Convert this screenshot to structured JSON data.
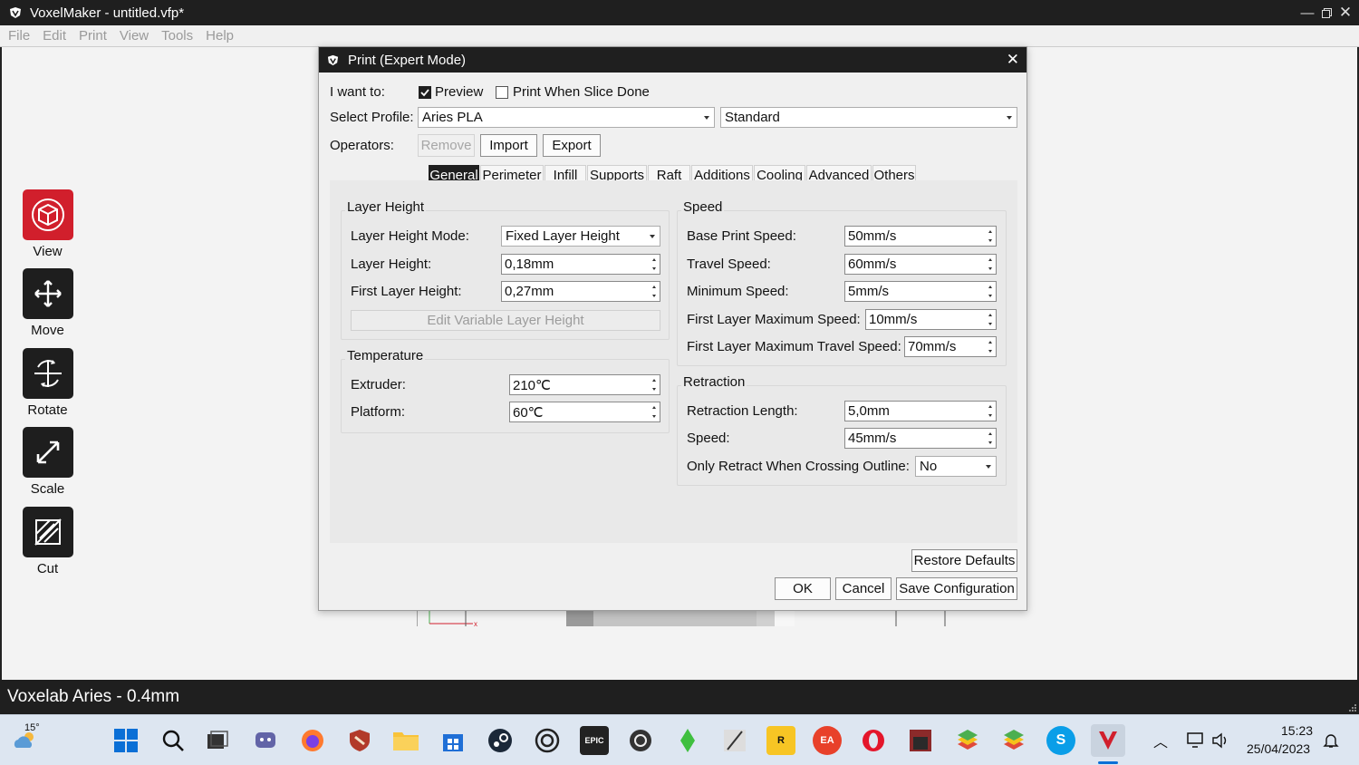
{
  "app": {
    "title": "VoxelMaker - untitled.vfp*"
  },
  "menu": [
    "File",
    "Edit",
    "Print",
    "View",
    "Tools",
    "Help"
  ],
  "tools": [
    {
      "label": "View",
      "icon": "view-cube-icon",
      "active": true
    },
    {
      "label": "Move",
      "icon": "move-arrows-icon",
      "active": false
    },
    {
      "label": "Rotate",
      "icon": "rotate-icon",
      "active": false
    },
    {
      "label": "Scale",
      "icon": "scale-icon",
      "active": false
    },
    {
      "label": "Cut",
      "icon": "cut-icon",
      "active": false
    }
  ],
  "dialog": {
    "title": "Print (Expert Mode)",
    "i_want_to_label": "I want to:",
    "preview_label": "Preview",
    "preview_checked": true,
    "print_when_done_label": "Print When Slice Done",
    "print_when_done_checked": false,
    "select_profile_label": "Select Profile:",
    "profile_value": "Aries PLA",
    "quality_value": "Standard",
    "operators_label": "Operators:",
    "remove_label": "Remove",
    "import_label": "Import",
    "export_label": "Export",
    "tabs": [
      "General",
      "Perimeter",
      "Infill",
      "Supports",
      "Raft",
      "Additions",
      "Cooling",
      "Advanced",
      "Others"
    ],
    "selected_tab": "General",
    "layer_height": {
      "title": "Layer Height",
      "mode_label": "Layer Height Mode:",
      "mode_value": "Fixed Layer Height",
      "height_label": "Layer Height:",
      "height_value": "0,18mm",
      "first_label": "First Layer Height:",
      "first_value": "0,27mm",
      "edit_variable_label": "Edit Variable Layer Height"
    },
    "temperature": {
      "title": "Temperature",
      "extruder_label": "Extruder:",
      "extruder_value": "210℃",
      "platform_label": "Platform:",
      "platform_value": "60℃"
    },
    "speed": {
      "title": "Speed",
      "base_label": "Base Print Speed:",
      "base_value": "50mm/s",
      "travel_label": "Travel Speed:",
      "travel_value": "60mm/s",
      "min_label": "Minimum Speed:",
      "min_value": "5mm/s",
      "first_max_label": "First Layer Maximum Speed:",
      "first_max_value": "10mm/s",
      "first_travel_label": "First Layer Maximum Travel Speed:",
      "first_travel_value": "70mm/s"
    },
    "retraction": {
      "title": "Retraction",
      "length_label": "Retraction Length:",
      "length_value": "5,0mm",
      "speed_label": "Speed:",
      "speed_value": "45mm/s",
      "only_label": "Only Retract When Crossing Outline:",
      "only_value": "No"
    },
    "restore_label": "Restore Defaults",
    "ok_label": "OK",
    "cancel_label": "Cancel",
    "save_label": "Save Configuration"
  },
  "status": {
    "printer": "Voxelab Aries - 0.4mm"
  },
  "taskbar": {
    "weather_temp": "15°",
    "time": "15:23",
    "date": "25/04/2023",
    "apps": [
      "windows-start-icon",
      "search-icon",
      "file-manager-icon",
      "chat-icon",
      "firefox-icon",
      "shield-app-icon",
      "folder-icon",
      "store-icon",
      "steam-icon",
      "ubisoft-icon",
      "epic-games-icon",
      "app-icon",
      "sims-plumbob-icon",
      "game-icon",
      "rockstar-icon",
      "ea-icon",
      "opera-icon",
      "game-icon-2",
      "bluestacks-icon",
      "bluestacks-icon-2",
      "skype-icon",
      "voxelmaker-icon"
    ]
  },
  "colors": {
    "accent": "#d11f2c",
    "dark": "#1f1f1f"
  }
}
